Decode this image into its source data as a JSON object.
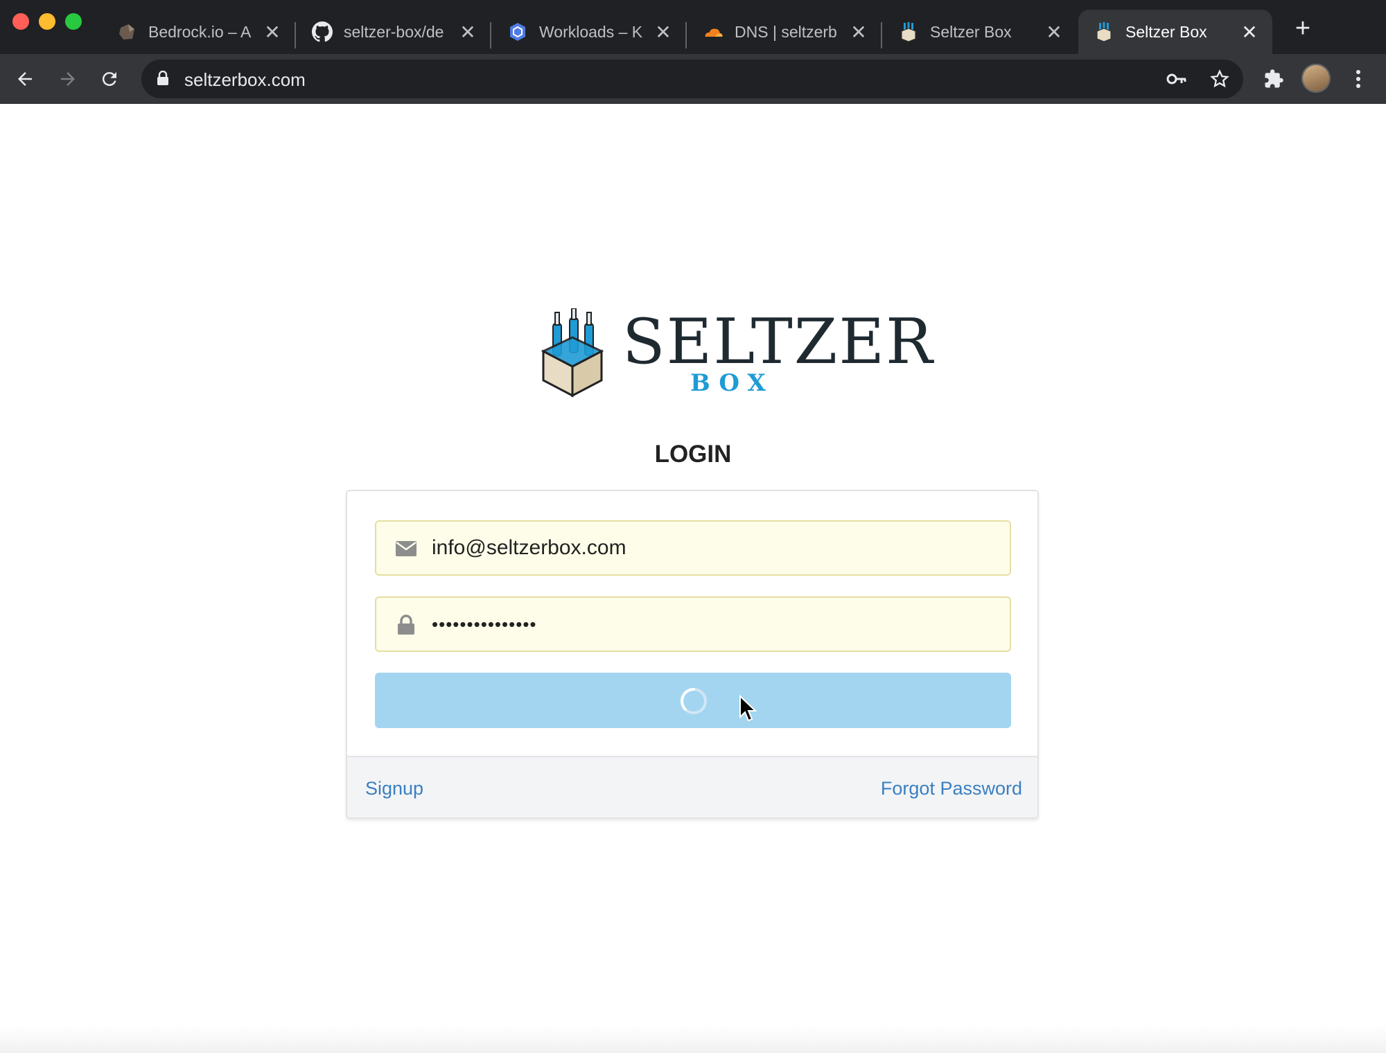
{
  "browser": {
    "tabs": [
      {
        "title": "Bedrock.io – A",
        "icon": "bedrock-rock-icon"
      },
      {
        "title": "seltzer-box/de",
        "icon": "github-icon"
      },
      {
        "title": "Workloads – K",
        "icon": "kubernetes-icon"
      },
      {
        "title": "DNS | seltzerb",
        "icon": "cloudflare-icon"
      },
      {
        "title": "Seltzer Box",
        "icon": "seltzer-box-icon"
      },
      {
        "title": "Seltzer Box",
        "icon": "seltzer-box-icon"
      }
    ],
    "active_tab": 5,
    "url": "seltzerbox.com"
  },
  "logo": {
    "word": "SELTZER",
    "sub": "BOX"
  },
  "login": {
    "heading": "LOGIN",
    "email_value": "info@seltzerbox.com",
    "password_value": "•••••••••••••••",
    "submit_state": "loading",
    "signup_label": "Signup",
    "forgot_label": "Forgot Password"
  },
  "colors": {
    "chrome_dark": "#202124",
    "chrome_toolbar": "#35363a",
    "field_bg": "#fdfde9",
    "button_bg": "#a3d5f0",
    "link": "#3a7fc0",
    "logo_blue": "#1f9bd5"
  }
}
